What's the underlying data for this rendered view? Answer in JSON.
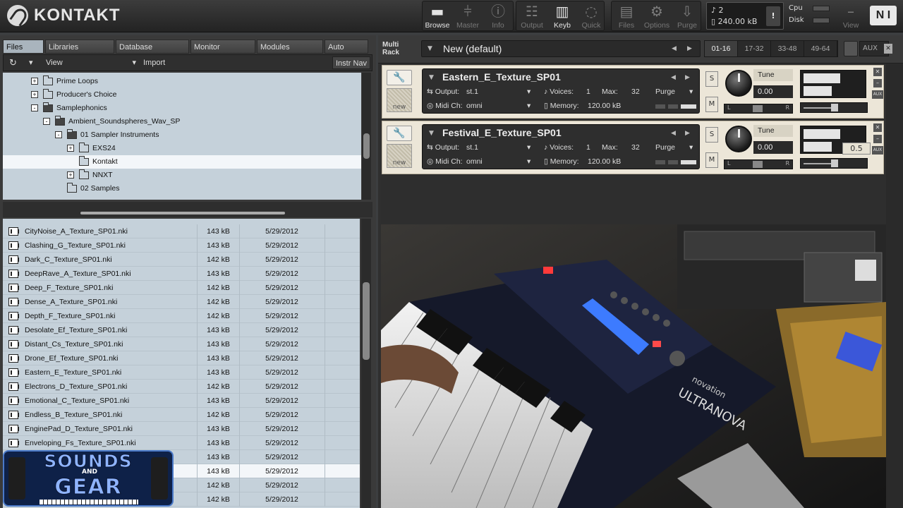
{
  "app": {
    "title": "KONTAKT"
  },
  "toolbar": {
    "buttons": [
      {
        "id": "browse",
        "label": "Browse",
        "icon": "folder-icon",
        "active": true
      },
      {
        "id": "master",
        "label": "Master",
        "icon": "mixer-icon",
        "active": false
      },
      {
        "id": "info",
        "label": "Info",
        "icon": "info-icon",
        "active": false
      },
      {
        "id": "output",
        "label": "Output",
        "icon": "output-faders-icon",
        "active": false
      },
      {
        "id": "keyb",
        "label": "Keyb",
        "icon": "keyboard-icon",
        "active": true
      },
      {
        "id": "quick",
        "label": "Quick",
        "icon": "quick-load-icon",
        "active": false
      },
      {
        "id": "files",
        "label": "Files",
        "icon": "files-icon",
        "active": false
      },
      {
        "id": "options",
        "label": "Options",
        "icon": "gear-icon",
        "active": false
      },
      {
        "id": "purge",
        "label": "Purge",
        "icon": "purge-icon",
        "active": false
      },
      {
        "id": "view",
        "label": "View",
        "icon": "minimize-icon",
        "active": false
      }
    ],
    "voices_count": "2",
    "memory": "240.00 kB",
    "warn": "!",
    "cpu_label": "Cpu",
    "disk_label": "Disk",
    "ni_logo": "N I"
  },
  "browser": {
    "tabs": [
      "Files",
      "Libraries",
      "Database",
      "Monitor",
      "Modules",
      "Auto"
    ],
    "active_tab": "Files",
    "view_label": "View",
    "import_label": "Import",
    "instr_nav_label": "Instr Nav",
    "tree": [
      {
        "label": "Prime Loops",
        "depth": 0,
        "pm": "+",
        "open": false
      },
      {
        "label": "Producer's Choice",
        "depth": 0,
        "pm": "+",
        "open": false
      },
      {
        "label": "Samplephonics",
        "depth": 0,
        "pm": "-",
        "open": true
      },
      {
        "label": "Ambient_Soundspheres_Wav_SP",
        "depth": 1,
        "pm": "-",
        "open": true
      },
      {
        "label": "01 Sampler Instruments",
        "depth": 2,
        "pm": "-",
        "open": true
      },
      {
        "label": "EXS24",
        "depth": 3,
        "pm": "+",
        "open": false
      },
      {
        "label": "Kontakt",
        "depth": 3,
        "pm": "",
        "open": false,
        "selected": true
      },
      {
        "label": "NNXT",
        "depth": 3,
        "pm": "+",
        "open": false
      },
      {
        "label": "02 Samples",
        "depth": 2,
        "pm": "",
        "open": false
      }
    ],
    "files": [
      {
        "name": "CityNoise_A_Texture_SP01.nki",
        "size": "143 kB",
        "date": "5/29/2012"
      },
      {
        "name": "Clashing_G_Texture_SP01.nki",
        "size": "143 kB",
        "date": "5/29/2012"
      },
      {
        "name": "Dark_C_Texture_SP01.nki",
        "size": "142 kB",
        "date": "5/29/2012"
      },
      {
        "name": "DeepRave_A_Texture_SP01.nki",
        "size": "143 kB",
        "date": "5/29/2012"
      },
      {
        "name": "Deep_F_Texture_SP01.nki",
        "size": "142 kB",
        "date": "5/29/2012"
      },
      {
        "name": "Dense_A_Texture_SP01.nki",
        "size": "142 kB",
        "date": "5/29/2012"
      },
      {
        "name": "Depth_F_Texture_SP01.nki",
        "size": "142 kB",
        "date": "5/29/2012"
      },
      {
        "name": "Desolate_Ef_Texture_SP01.nki",
        "size": "143 kB",
        "date": "5/29/2012"
      },
      {
        "name": "Distant_Cs_Texture_SP01.nki",
        "size": "143 kB",
        "date": "5/29/2012"
      },
      {
        "name": "Drone_Ef_Texture_SP01.nki",
        "size": "143 kB",
        "date": "5/29/2012"
      },
      {
        "name": "Eastern_E_Texture_SP01.nki",
        "size": "143 kB",
        "date": "5/29/2012"
      },
      {
        "name": "Electrons_D_Texture_SP01.nki",
        "size": "142 kB",
        "date": "5/29/2012"
      },
      {
        "name": "Emotional_C_Texture_SP01.nki",
        "size": "143 kB",
        "date": "5/29/2012"
      },
      {
        "name": "Endless_B_Texture_SP01.nki",
        "size": "142 kB",
        "date": "5/29/2012"
      },
      {
        "name": "EnginePad_D_Texture_SP01.nki",
        "size": "143 kB",
        "date": "5/29/2012"
      },
      {
        "name": "Enveloping_Fs_Texture_SP01.nki",
        "size": "143 kB",
        "date": "5/29/2012"
      },
      {
        "name": "",
        "size": "143 kB",
        "date": "5/29/2012"
      },
      {
        "name": "",
        "size": "143 kB",
        "date": "5/29/2012",
        "selected": true
      },
      {
        "name": "",
        "size": "142 kB",
        "date": "5/29/2012"
      },
      {
        "name": "",
        "size": "142 kB",
        "date": "5/29/2012"
      }
    ]
  },
  "rack": {
    "label_line1": "Multi",
    "label_line2": "Rack",
    "preset": "New (default)",
    "pages": [
      "01-16",
      "17-32",
      "33-48",
      "49-64"
    ],
    "active_page": "01-16",
    "aux_label": "AUX",
    "instruments": [
      {
        "name": "Eastern_E_Texture_SP01",
        "output": "st.1",
        "voices": "1",
        "max": "32",
        "midi": "omni",
        "memory": "120.00 kB",
        "tune": "0.00",
        "purge": "Purge"
      },
      {
        "name": "Festival_E_Texture_SP01",
        "output": "st.1",
        "voices": "1",
        "max": "32",
        "midi": "omni",
        "memory": "120.00 kB",
        "tune": "0.00",
        "purge": "Purge"
      }
    ],
    "labels": {
      "output": "Output:",
      "voices": "Voices:",
      "max": "Max:",
      "midi": "Midi Ch:",
      "memory": "Memory:",
      "tune": "Tune",
      "new": "new",
      "solo": "S",
      "mute": "M",
      "aux": "AUX"
    },
    "volume_tooltip": "0.5",
    "volume_level": 0.5
  },
  "watermark": {
    "line1": "SOUNDS",
    "and": "AND",
    "line2": "GEAR"
  },
  "video": {
    "brand": "novation",
    "model": "ULTRANOVA"
  }
}
